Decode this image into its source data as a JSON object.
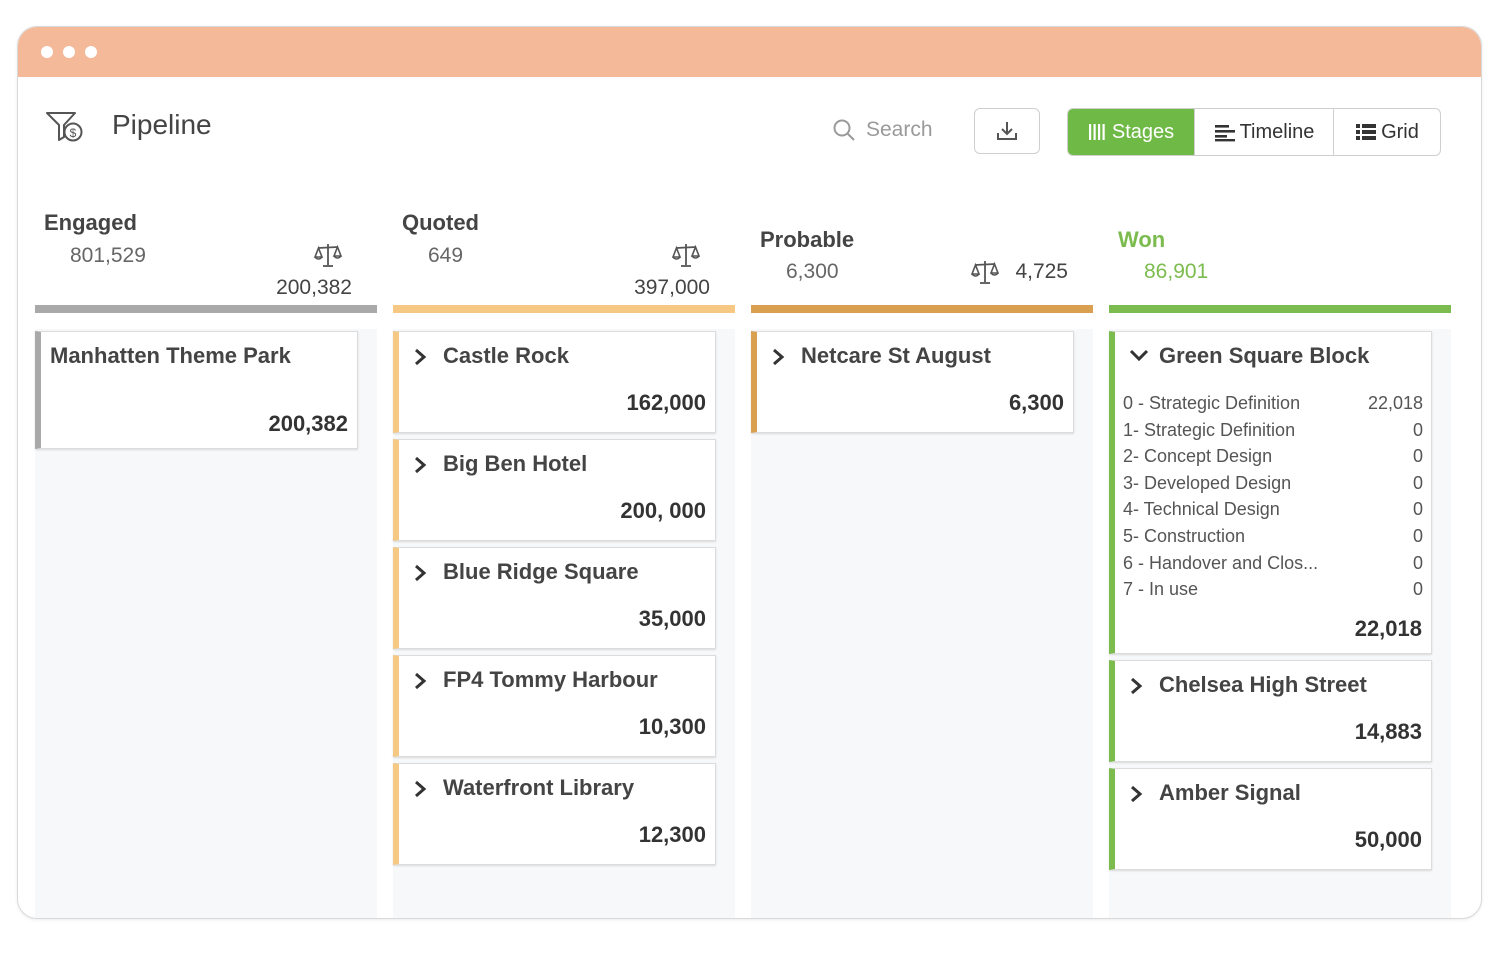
{
  "app": {
    "title": "Pipeline",
    "icon": "funnel-dollar-icon"
  },
  "search": {
    "placeholder": "Search"
  },
  "toolbar": {
    "download_icon": "download-icon"
  },
  "views": [
    {
      "label": "Stages",
      "icon": "stages-icon",
      "active": true
    },
    {
      "label": "Timeline",
      "icon": "timeline-icon",
      "active": false
    },
    {
      "label": "Grid",
      "icon": "grid-icon",
      "active": false
    }
  ],
  "colors": {
    "titlebar": "#f4b998",
    "engaged": "#a9a9a9",
    "quoted": "#f5c983",
    "probable": "#d9a04f",
    "won": "#7cbc4f",
    "active_view": "#6fb946"
  },
  "stages": [
    {
      "name": "Engaged",
      "count": "801,529",
      "weighted": "200,382",
      "cards": [
        {
          "title": "Manhatten Theme Park",
          "value": "200,382"
        }
      ]
    },
    {
      "name": "Quoted",
      "count": "649",
      "weighted": "397,000",
      "cards": [
        {
          "title": "Castle Rock",
          "value": "162,000"
        },
        {
          "title": "Big Ben Hotel",
          "value": "200, 000"
        },
        {
          "title": "Blue Ridge Square",
          "value": "35,000"
        },
        {
          "title": "FP4 Tommy Harbour",
          "value": "10,300"
        },
        {
          "title": "Waterfront Library",
          "value": "12,300"
        }
      ]
    },
    {
      "name": "Probable",
      "count": "6,300",
      "weighted": "4,725",
      "cards": [
        {
          "title": "Netcare St August",
          "value": "6,300"
        }
      ]
    },
    {
      "name": "Won",
      "count": "86,901",
      "cards": [
        {
          "title": "Green Square Block",
          "value": "22,018",
          "expanded": true,
          "rows": [
            {
              "label": "0 - Strategic Definition",
              "value": "22,018"
            },
            {
              "label": "1- Strategic Definition",
              "value": "0"
            },
            {
              "label": "2- Concept Design",
              "value": "0"
            },
            {
              "label": "3- Developed Design",
              "value": "0"
            },
            {
              "label": "4- Technical Design",
              "value": "0"
            },
            {
              "label": "5- Construction",
              "value": "0"
            },
            {
              "label": "6 - Handover and Clos...",
              "value": "0"
            },
            {
              "label": "7 - In use",
              "value": "0"
            }
          ]
        },
        {
          "title": "Chelsea High Street",
          "value": "14,883"
        },
        {
          "title": "Amber Signal",
          "value": "50,000"
        }
      ]
    }
  ]
}
